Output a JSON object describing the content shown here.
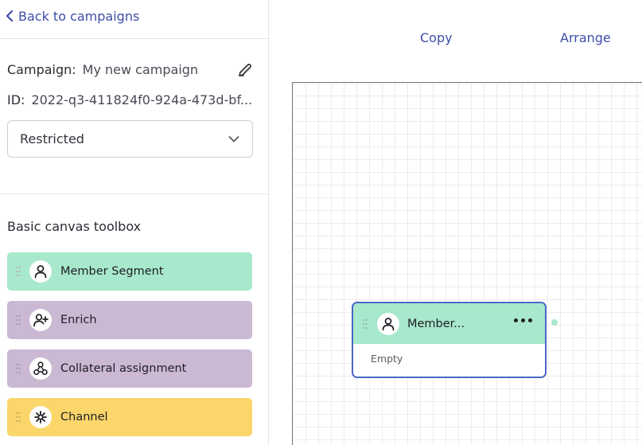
{
  "sidebar": {
    "back_label": "Back to campaigns",
    "campaign_key": "Campaign:",
    "campaign_value": "My new campaign",
    "id_key": "ID:",
    "id_value": "2022-q3-411824f0-924a-473d-bf...",
    "visibility_selected": "Restricted",
    "toolbox_title": "Basic canvas toolbox",
    "tools": [
      {
        "label": "Member Segment",
        "icon": "person-icon",
        "color": "#a8e8cc"
      },
      {
        "label": "Enrich",
        "icon": "person-plus-icon",
        "color": "#cbb8d3"
      },
      {
        "label": "Collateral assignment",
        "icon": "nodes-icon",
        "color": "#cbb8d3"
      },
      {
        "label": "Channel",
        "icon": "asterisk-icon",
        "color": "#fad66b"
      }
    ]
  },
  "toolbar": {
    "copy_label": "Copy",
    "arrange_label": "Arrange"
  },
  "canvas": {
    "node": {
      "title": "Member...",
      "body": "Empty",
      "icon": "person-icon",
      "header_color": "#a8e8cc",
      "border_color": "#4a68c9"
    }
  },
  "colors": {
    "accent": "#3e4da8"
  }
}
